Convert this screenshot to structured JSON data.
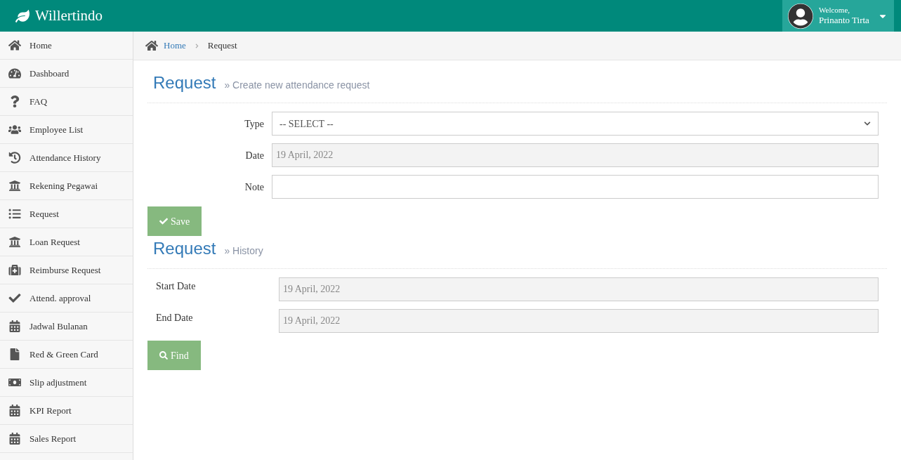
{
  "brand": {
    "name": "Willertindo"
  },
  "user": {
    "greeting": "Welcome,",
    "name": "Prinanto Tirta"
  },
  "sidebar": {
    "items": [
      {
        "label": "Home"
      },
      {
        "label": "Dashboard"
      },
      {
        "label": "FAQ"
      },
      {
        "label": "Employee List"
      },
      {
        "label": "Attendance History"
      },
      {
        "label": "Rekening Pegawai"
      },
      {
        "label": "Request"
      },
      {
        "label": "Loan Request"
      },
      {
        "label": "Reimburse Request"
      },
      {
        "label": "Attend. approval"
      },
      {
        "label": "Jadwal Bulanan"
      },
      {
        "label": "Red & Green Card"
      },
      {
        "label": "Slip adjustment"
      },
      {
        "label": "KPI Report"
      },
      {
        "label": "Sales Report"
      }
    ]
  },
  "breadcrumb": [
    {
      "label": "Home"
    },
    {
      "label": "Request"
    }
  ],
  "sections": [
    {
      "title": "Request",
      "subtitle": "» Create new attendance request",
      "fields": [
        {
          "label": "Type",
          "kind": "select",
          "value": "-- SELECT --",
          "disabled": false
        },
        {
          "label": "Date",
          "kind": "text",
          "value": "19 April, 2022",
          "disabled": true
        },
        {
          "label": "Note",
          "kind": "text",
          "disabled": false
        }
      ],
      "button": {
        "label": "Save"
      }
    },
    {
      "title": "Request",
      "subtitle": "» History",
      "fields": [
        {
          "label": "Start Date",
          "kind": "text",
          "value": "19 April, 2022",
          "disabled": true
        },
        {
          "label": "End Date",
          "kind": "text",
          "value": "19 April, 2022",
          "disabled": true
        }
      ],
      "button": {
        "label": "Find"
      }
    }
  ]
}
